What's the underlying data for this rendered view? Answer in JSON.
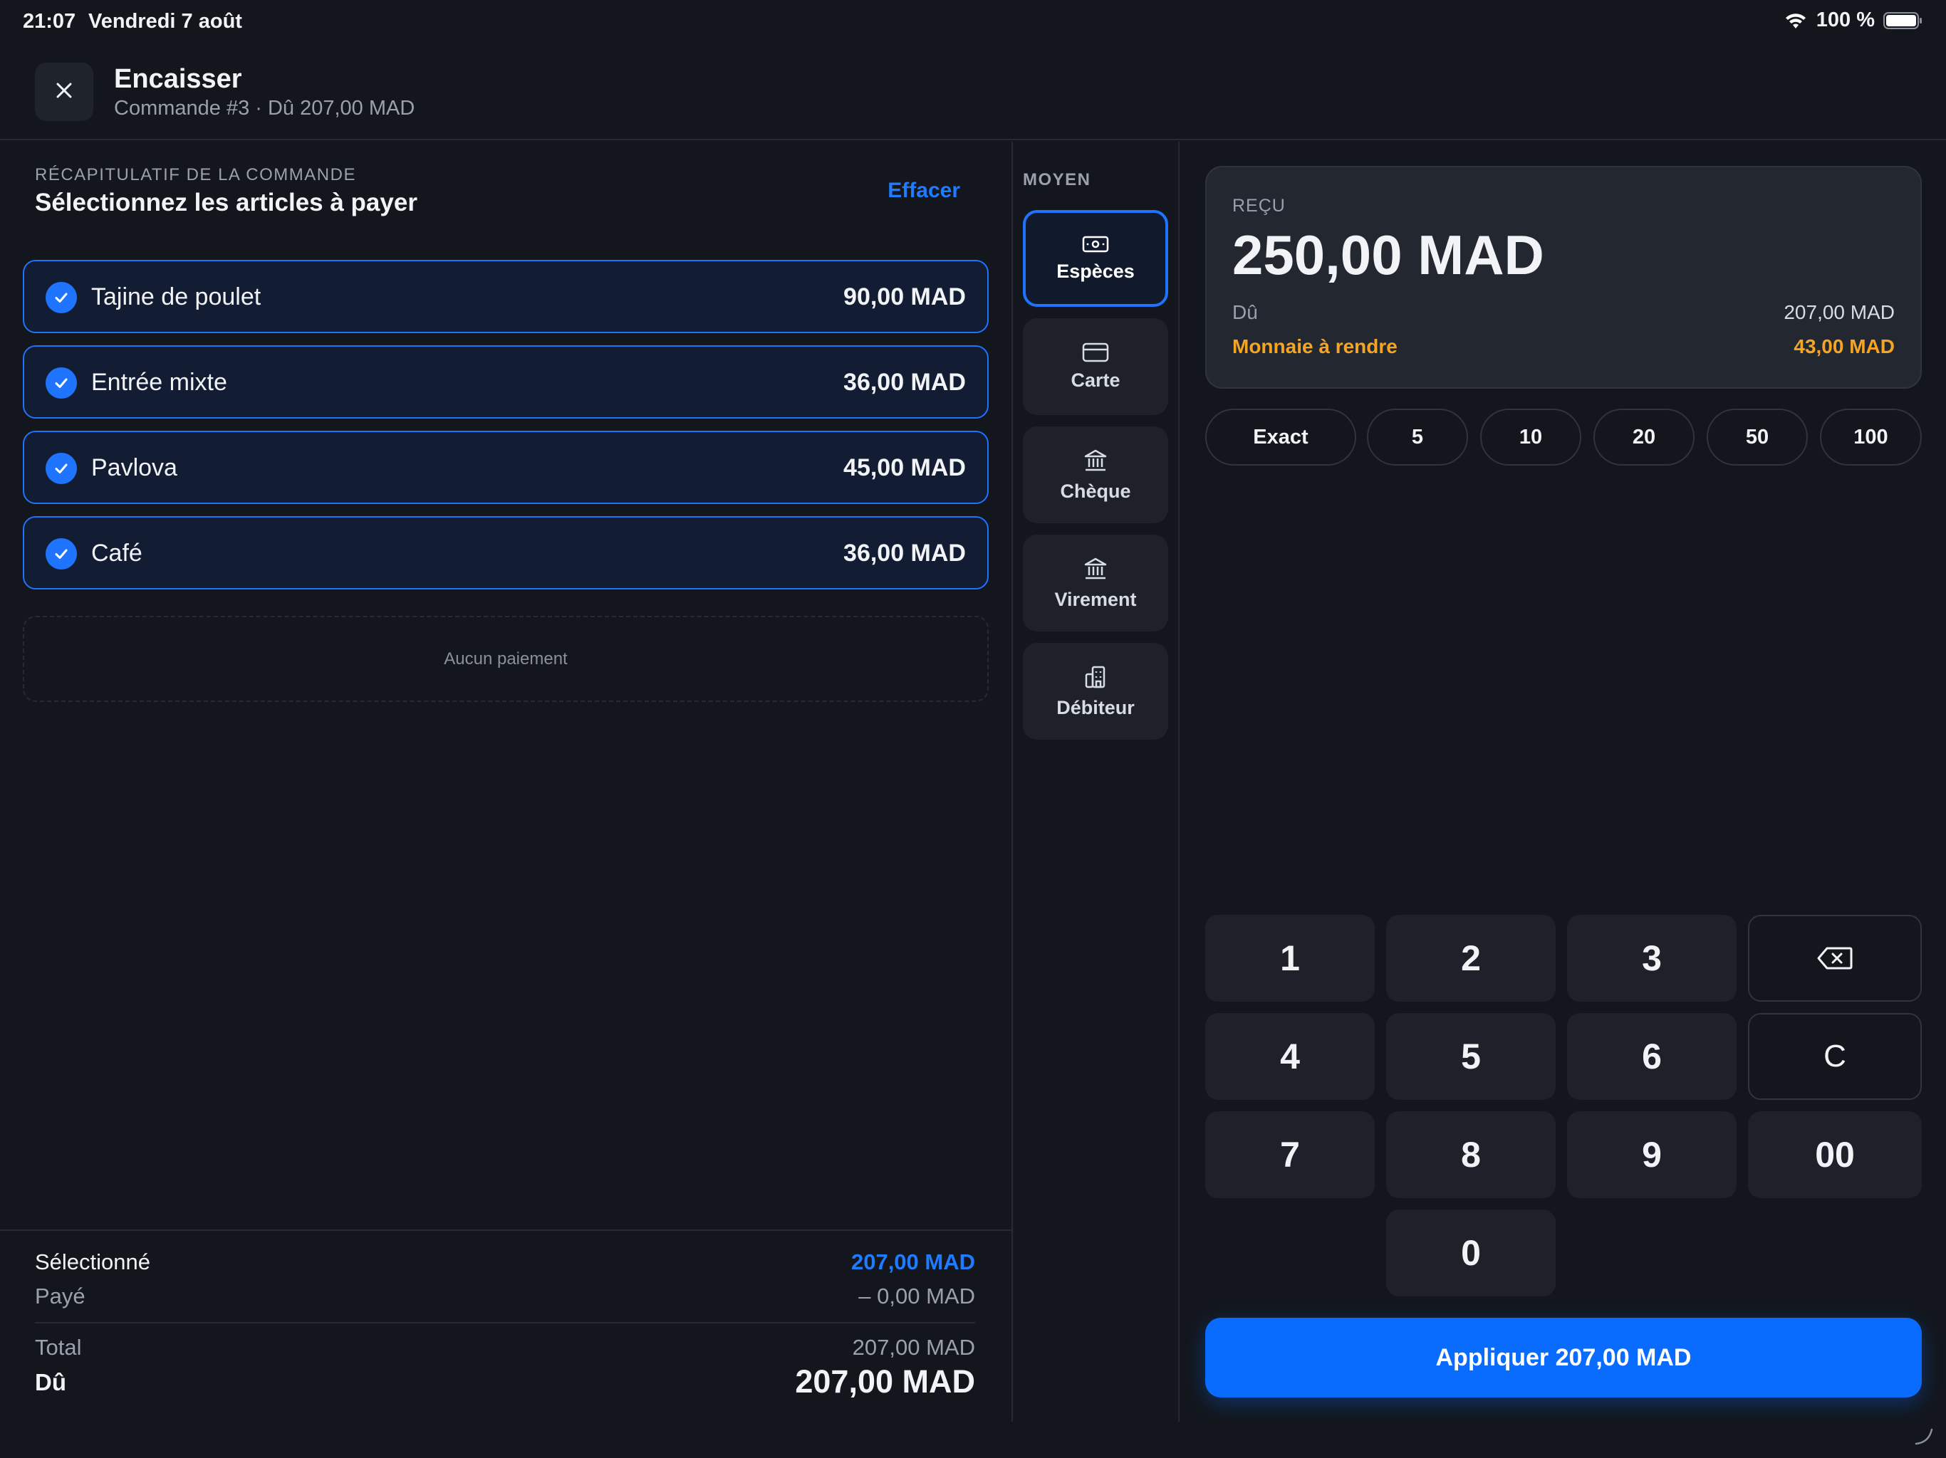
{
  "status_bar": {
    "time": "21:07",
    "date": "Vendredi 7 août",
    "battery_text": "100 %",
    "icons": [
      "wifi-icon",
      "battery-icon"
    ]
  },
  "header": {
    "title": "Encaisser",
    "subtitle": "Commande #3 · Dû 207,00 MAD",
    "close_icon": "close-icon"
  },
  "order": {
    "recap_label": "RÉCAPITULATIF DE LA COMMANDE",
    "title": "Sélectionnez les articles à payer",
    "clear_label": "Effacer",
    "items": [
      {
        "name": "Tajine de poulet",
        "price": "90,00 MAD",
        "selected": true
      },
      {
        "name": "Entrée mixte",
        "price": "36,00 MAD",
        "selected": true
      },
      {
        "name": "Pavlova",
        "price": "45,00 MAD",
        "selected": true
      },
      {
        "name": "Café",
        "price": "36,00 MAD",
        "selected": true
      }
    ],
    "no_payment": "Aucun paiement"
  },
  "summary": {
    "selected_label": "Sélectionné",
    "selected_value": "207,00 MAD",
    "paid_label": "Payé",
    "paid_value": "– 0,00 MAD",
    "total_label": "Total",
    "total_value": "207,00 MAD",
    "due_label": "Dû",
    "due_value": "207,00 MAD"
  },
  "methods": {
    "label": "MOYEN",
    "items": [
      {
        "label": "Espèces",
        "icon": "cash-icon",
        "active": true
      },
      {
        "label": "Carte",
        "icon": "card-icon",
        "active": false
      },
      {
        "label": "Chèque",
        "icon": "bank-icon",
        "active": false
      },
      {
        "label": "Virement",
        "icon": "bank-icon",
        "active": false
      },
      {
        "label": "Débiteur",
        "icon": "building-icon",
        "active": false
      }
    ]
  },
  "received": {
    "label": "REÇU",
    "amount": "250,00 MAD",
    "due_label": "Dû",
    "due_value": "207,00 MAD",
    "change_label": "Monnaie à rendre",
    "change_value": "43,00 MAD"
  },
  "quick_amounts": [
    "Exact",
    "5",
    "10",
    "20",
    "50",
    "100"
  ],
  "keypad": {
    "keys": [
      "1",
      "2",
      "3",
      "4",
      "5",
      "6",
      "7",
      "8",
      "9",
      "00",
      "0"
    ],
    "clear": "C",
    "backspace_icon": "backspace-icon"
  },
  "apply_label": "Appliquer 207,00 MAD",
  "colors": {
    "accent": "#1f74ff",
    "change": "#f5a524",
    "background": "#13161c"
  }
}
